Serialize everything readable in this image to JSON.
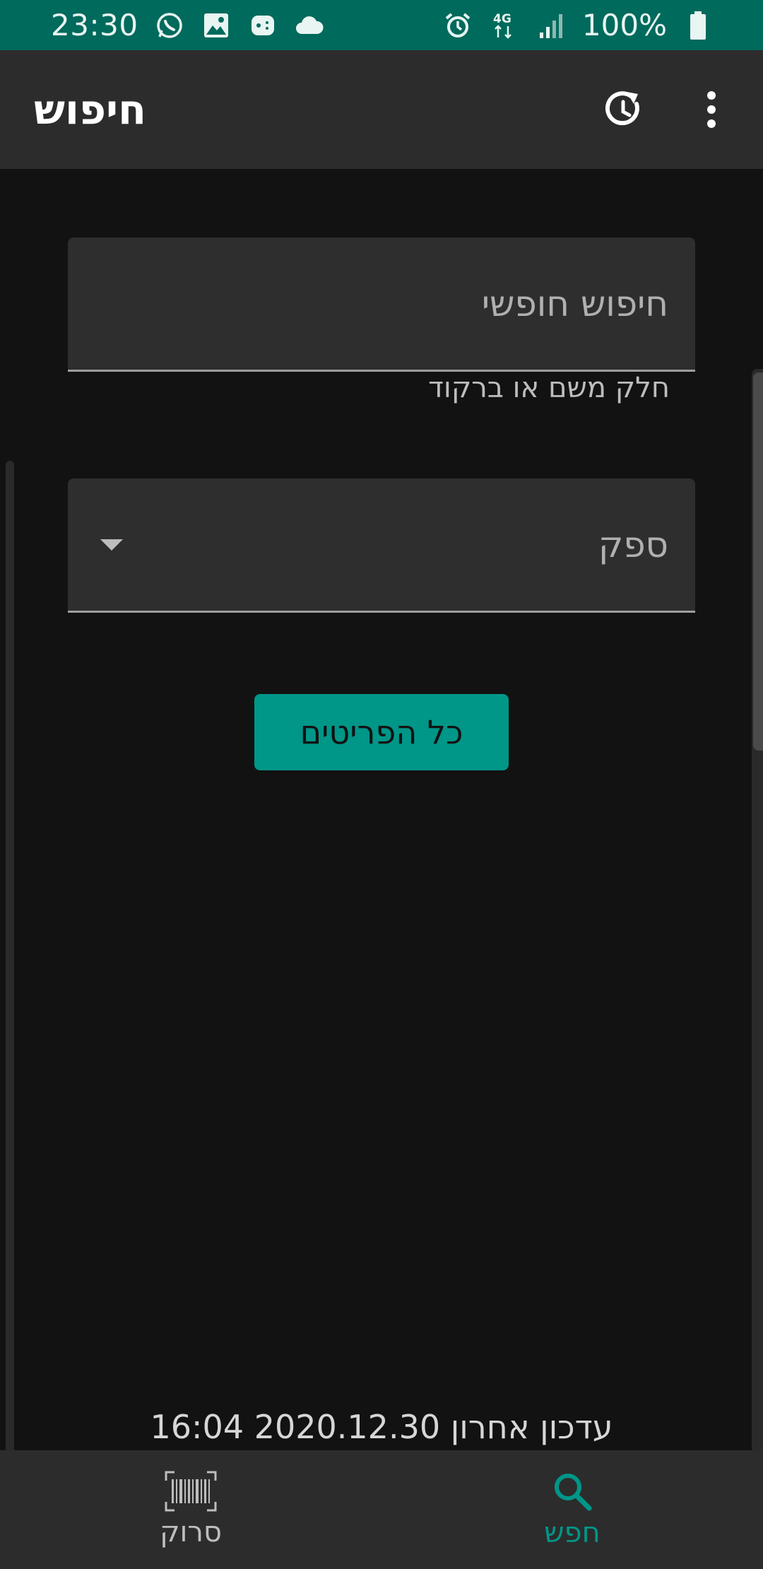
{
  "status_bar": {
    "time": "23:30",
    "notification_icons": [
      "whatsapp-icon",
      "gallery-icon",
      "game-icon",
      "cloud-icon"
    ],
    "system_icons": [
      "alarm-icon",
      "4g-icon",
      "signal-icon",
      "battery-icon"
    ],
    "battery": "100%"
  },
  "app_bar": {
    "title": "חיפוש",
    "actions": [
      "history-refresh-icon",
      "more-vert-icon"
    ]
  },
  "search": {
    "placeholder": "חיפוש חופשי",
    "helper": "חלק משם או ברקוד"
  },
  "supplier": {
    "label": "ספק"
  },
  "all_items_button": "כל הפריטים",
  "last_update": "עדכון אחרון 2020.12.30 16:04",
  "bottom_nav": {
    "items": [
      {
        "label": "סרוק",
        "icon": "barcode-scan-icon",
        "active": false
      },
      {
        "label": "חפש",
        "icon": "search-icon",
        "active": true
      }
    ]
  },
  "colors": {
    "status_bar": "#006a5c",
    "accent": "#009688",
    "background": "#121212",
    "surface": "#2c2c2c"
  }
}
